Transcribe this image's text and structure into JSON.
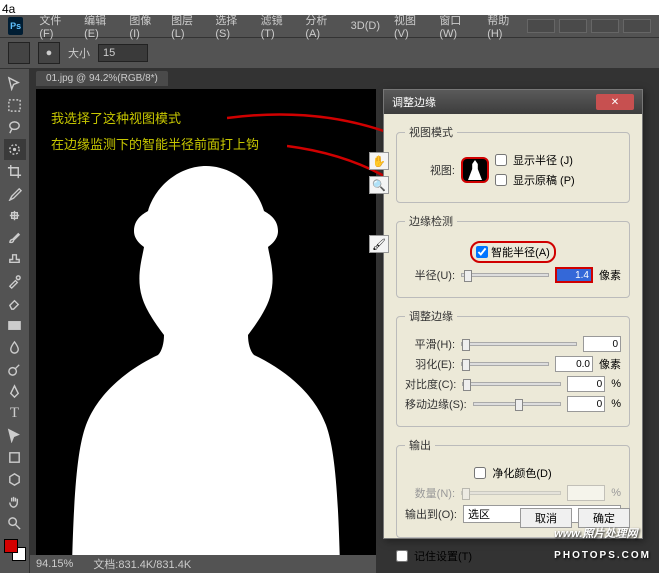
{
  "page_label": "4a",
  "menu": {
    "logo": "Ps",
    "items": [
      "文件(F)",
      "编辑(E)",
      "图像(I)",
      "图层(L)",
      "选择(S)",
      "滤镜(T)",
      "分析(A)",
      "3D(D)",
      "视图(V)",
      "窗口(W)",
      "帮助(H)"
    ]
  },
  "options": {
    "size_label": "大小",
    "size_value": "15"
  },
  "doc": {
    "tab": "01.jpg @ 94.2%(RGB/8*)",
    "zoom": "94.15%",
    "filesize": "文档:831.4K/831.4K"
  },
  "annotations": {
    "line1": "我选择了这种视图模式",
    "line2": "在边缘监测下的智能半径前面打上钩"
  },
  "dialog": {
    "title": "调整边缘",
    "view_mode": {
      "legend": "视图模式",
      "view_label": "视图:",
      "show_radius": "显示半径 (J)",
      "show_original": "显示原稿 (P)"
    },
    "edge_detect": {
      "legend": "边缘检测",
      "smart_radius": "智能半径(A)",
      "radius_label": "半径(U):",
      "radius_value": "1.4",
      "radius_unit": "像素"
    },
    "adjust": {
      "legend": "调整边缘",
      "smooth": "平滑(H):",
      "smooth_val": "0",
      "feather": "羽化(E):",
      "feather_val": "0.0",
      "feather_unit": "像素",
      "contrast": "对比度(C):",
      "contrast_val": "0",
      "contrast_unit": "%",
      "shift": "移动边缘(S):",
      "shift_val": "0",
      "shift_unit": "%"
    },
    "output": {
      "legend": "输出",
      "decon": "净化颜色(D)",
      "amount": "数量(N):",
      "output_to": "输出到(O):",
      "output_val": "选区"
    },
    "remember": "记住设置(T)",
    "buttons": {
      "cancel": "取消",
      "ok": "确定"
    }
  },
  "watermark": {
    "main": "照片处理网",
    "sub": "PHOTOPS.COM",
    "www": "www."
  }
}
